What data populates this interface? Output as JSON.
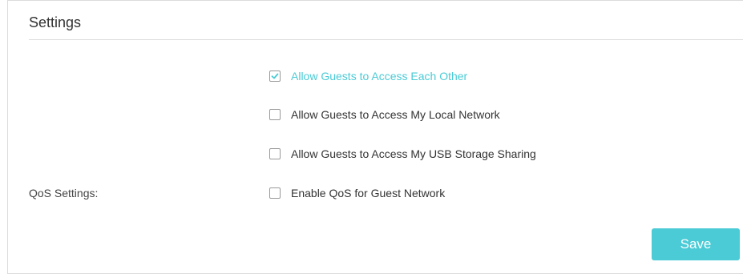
{
  "section": {
    "title": "Settings"
  },
  "options": [
    {
      "label": "Allow Guests to Access Each Other",
      "checked": true
    },
    {
      "label": "Allow Guests to Access My Local Network",
      "checked": false
    },
    {
      "label": "Allow Guests to Access My USB Storage Sharing",
      "checked": false
    },
    {
      "label": "Enable QoS for Guest Network",
      "checked": false
    }
  ],
  "qos": {
    "label": "QoS Settings:"
  },
  "actions": {
    "save_label": "Save"
  },
  "colors": {
    "accent": "#4acbd6",
    "text": "#333333",
    "border": "#dcdcdc"
  }
}
